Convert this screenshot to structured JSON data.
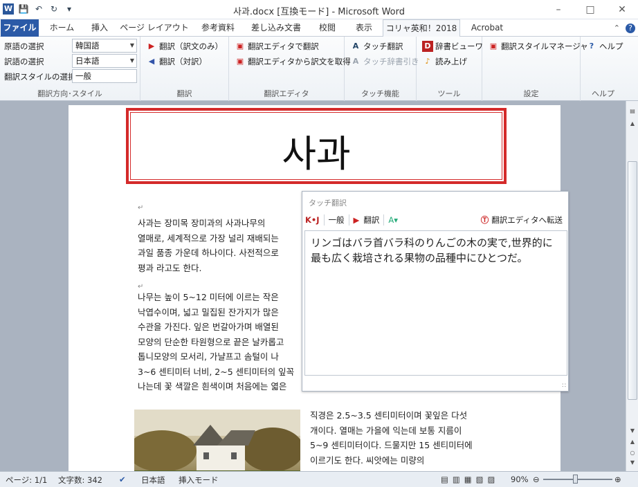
{
  "window": {
    "title": "사과.docx [互換モード] - Microsoft Word"
  },
  "tabs": [
    "ファイル",
    "ホーム",
    "挿入",
    "ページ レイアウト",
    "参考資料",
    "差し込み文書",
    "校閲",
    "表示",
    "コリャ英和！2018",
    "Acrobat"
  ],
  "ribbon": {
    "lang": {
      "src_label": "原語の選択",
      "src_value": "韓国語",
      "dst_label": "訳語の選択",
      "dst_value": "日本語",
      "style_label": "翻訳スタイルの選択",
      "style_value": "一般",
      "group": "翻訳方向･スタイル"
    },
    "translate": {
      "item1": "翻訳（訳文のみ）",
      "item2": "翻訳（対訳）",
      "group": "翻訳"
    },
    "editor": {
      "item1": "翻訳エディタで翻訳",
      "item2": "翻訳エディタから訳文を取得",
      "group": "翻訳エディタ"
    },
    "touch": {
      "item1": "タッチ翻訳",
      "item2": "タッチ辞書引き",
      "group": "タッチ機能"
    },
    "tools": {
      "item1": "辞書ビューワ",
      "item2": "読み上げ",
      "group": "ツール"
    },
    "settings": {
      "item1": "翻訳スタイルマネージャ",
      "group": "設定"
    },
    "help": {
      "item1": "ヘルプ",
      "group": "ヘルプ"
    }
  },
  "doc": {
    "title": "사과",
    "p1": [
      "사과는 장미목 장미과의 사과나무의",
      "열매로, 세계적으로 가장 널리 재배되는",
      "과일 품종 가운데 하나이다. 사전적으로",
      "평과 라고도 한다."
    ],
    "p2": [
      "나무는 높이 5~12 미터에 이르는 작은",
      "낙엽수이며, 넓고 밀집된 잔가지가 많은",
      "수관을 가진다. 잎은 번갈아가며 배열된",
      "모양의 단순한 타원형으로 끝은 날카롭고",
      "톱니모양의 모서리, 가냘프고 솜털이 나",
      "3~6 센티미터 너비, 2~5 센티미터의 잎꼭",
      "나는데 꽃 색깔은 흰색이며 처음에는 엷은"
    ],
    "p3": [
      "직경은 2.5~3.5 센티미터이며 꽃잎은 다섯",
      "개이다. 열매는 가을에 익는데 보통 지름이",
      "5~9 센티미터이다. 드물지만 15 센티미터에",
      "이르기도 한다. 씨앗에는 미량의"
    ]
  },
  "touch_panel": {
    "title": "タッチ翻訳",
    "kj": "K•J",
    "style": "一般",
    "translate": "翻訳",
    "send": "翻訳エディタへ転送",
    "text": "リンゴはバラ首バラ科のりんごの木の実で,世界的に最も広く栽培される果物の品種中にひとつだ。"
  },
  "status": {
    "page": "ページ: 1/1",
    "words": "文字数: 342",
    "lang": "日本語",
    "mode": "挿入モード",
    "zoom": "90%"
  },
  "colors": {
    "accent": "#2b5aa7",
    "title_border": "#d42a2a"
  }
}
